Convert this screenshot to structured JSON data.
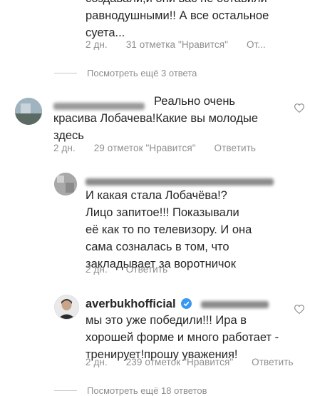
{
  "thread1": {
    "text_lines": [
      "создавали,и они вас не оставили",
      "равнодушными!! А все остальное",
      "суета..."
    ],
    "meta": {
      "time": "2 дн.",
      "likes": "31 отметка \"Нравится\"",
      "reply": "От..."
    }
  },
  "view_more_1": "Посмотреть ещё 3 ответа",
  "comment2": {
    "inline_text": "Реально очень",
    "text_lines": [
      "красива Лобачева!Какие вы молодые",
      "здесь"
    ],
    "meta": {
      "time": "2 дн.",
      "likes": "29 отметок \"Нравится\"",
      "reply": "Ответить"
    }
  },
  "reply1": {
    "text_lines": [
      "И какая стала Лобачёва!?",
      "Лицо запитое!!! Показывали",
      "её как то по телевизору. И она",
      "сама созналась в том, что",
      "закладывает за воротничок"
    ],
    "meta": {
      "time": "2 дн.",
      "reply": "Ответить"
    }
  },
  "reply2": {
    "username": "averbukhofficial",
    "text_lines": [
      "мы это уже победили!!! Ира в",
      "хорошей форме и много работает -",
      "тренирует!прошу уважения!"
    ],
    "meta": {
      "time": "2 дн.",
      "likes": "239 отметок \"Нравится\"",
      "reply": "Ответить"
    }
  },
  "view_more_2": "Посмотреть ещё 18 ответов",
  "colors": {
    "verified": "#3897f0",
    "meta_gray": "#8e8e8e",
    "text": "#262626"
  },
  "icons": [
    "heart-outline-icon",
    "verified-badge-icon"
  ]
}
